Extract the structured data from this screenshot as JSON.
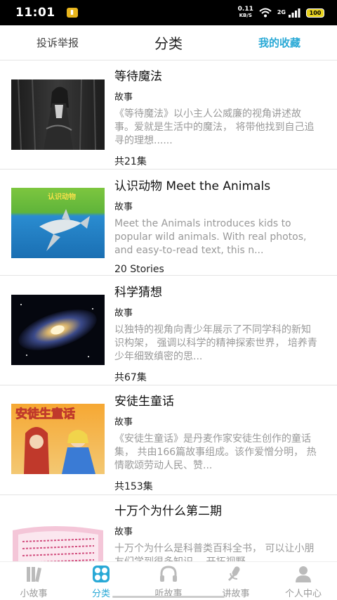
{
  "status_bar": {
    "time": "11:01",
    "net_speed_value": "0.11",
    "net_speed_unit": "KB/S",
    "network_type": "2G",
    "battery": "100"
  },
  "header": {
    "left_action": "投诉举报",
    "title": "分类",
    "right_action": "我的收藏"
  },
  "items": [
    {
      "title": "等待魔法",
      "category": "故事",
      "description": "《等待魔法》以小主人公威廉的视角讲述故事。爱就是生活中的魔法， 将带他找到自己追寻的理想......",
      "count": "共21集"
    },
    {
      "title": "认识动物 Meet the Animals",
      "category": "故事",
      "description": "Meet the Animals introduces kids to popular wild animals. With real photos, and easy-to-read text, this n...",
      "count": "20 Stories",
      "thumb_text": "认识动物"
    },
    {
      "title": "科学猜想",
      "category": "故事",
      "description": "以独特的视角向青少年展示了不同学科的新知识构架， 强调以科学的精神探索世界， 培养青少年细致缜密的思...",
      "count": "共67集"
    },
    {
      "title": "安徒生童话",
      "category": "故事",
      "description": "《安徒生童话》是丹麦作家安徒生创作的童话集， 共由166篇故事组成。该作爱憎分明， 热情歌颂劳动人民、赞...",
      "count": "共153集",
      "thumb_text": "安徒生童话"
    },
    {
      "title": "十万个为什么第二期",
      "category": "故事",
      "description": "十万个为什么是科普类百科全书， 可以让小朋友们学到很多知识， 开拓视野...",
      "count": ""
    }
  ],
  "nav": [
    {
      "label": "小故事",
      "icon": "books-icon"
    },
    {
      "label": "分类",
      "icon": "category-icon"
    },
    {
      "label": "听故事",
      "icon": "headphones-icon"
    },
    {
      "label": "讲故事",
      "icon": "microphone-icon"
    },
    {
      "label": "个人中心",
      "icon": "person-icon"
    }
  ],
  "colors": {
    "accent": "#29a9d6",
    "inactive": "#999999"
  }
}
